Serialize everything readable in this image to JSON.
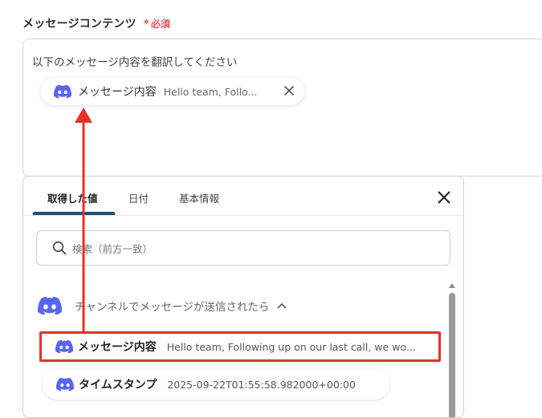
{
  "field": {
    "label": "メッセージコンテンツ",
    "required_star": "*",
    "required_text": "必須"
  },
  "editor": {
    "text": "以下のメッセージ内容を翻訳してください",
    "chip": {
      "icon": "discord-icon",
      "label": "メッセージ内容",
      "value": "Hello team, Follo..."
    }
  },
  "panel": {
    "tabs": [
      {
        "label": "取得した値",
        "active": true
      },
      {
        "label": "日付",
        "active": false
      },
      {
        "label": "基本情報",
        "active": false
      }
    ],
    "search": {
      "placeholder": "検索（前方一致）",
      "value": ""
    },
    "section": {
      "icon": "discord-icon",
      "title": "チャンネルでメッセージが送信されたら"
    },
    "rows": [
      {
        "label": "メッセージ内容",
        "value": "Hello team, Following up on our last call, we wo...",
        "selected": true
      },
      {
        "label": "タイムスタンプ",
        "value": "2025-09-22T01:55:58.982000+00:00",
        "selected": false
      }
    ]
  },
  "colors": {
    "discord": "#5865f2",
    "required": "#e8505b",
    "highlight": "#e4312b",
    "tab_underline": "#1f4f6d"
  }
}
